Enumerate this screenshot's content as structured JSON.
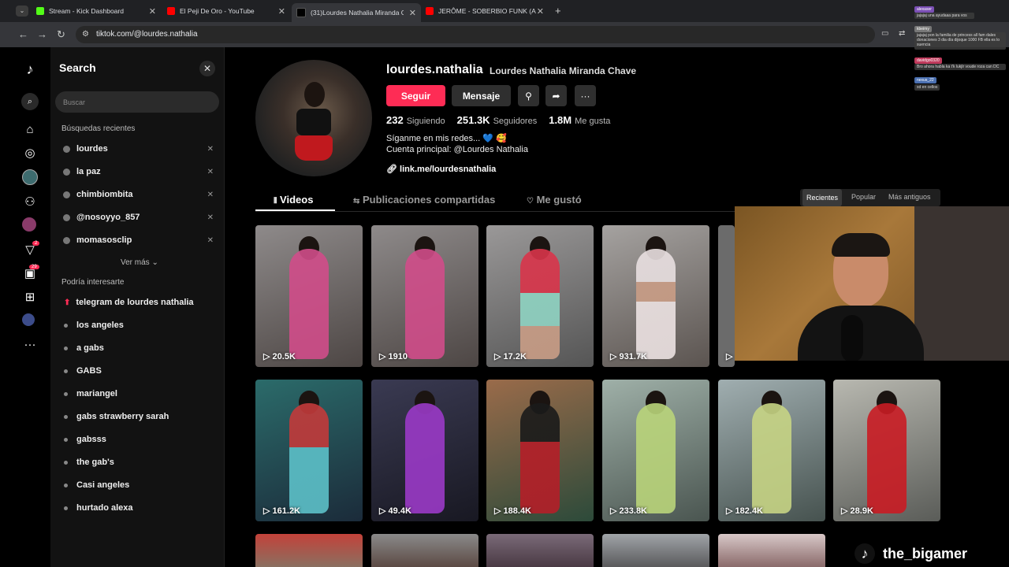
{
  "browser": {
    "tabs": [
      {
        "title": "Stream - Kick Dashboard",
        "fav_color": "#53fc18"
      },
      {
        "title": "El Peji De Oro - YouTube",
        "fav_color": "#ff0000"
      },
      {
        "title": "(31)Lourdes Nathalia Miranda C",
        "fav_color": "#000000"
      },
      {
        "title": "JERÔME - SOBERBIO FUNK (Au",
        "fav_color": "#ff0000"
      }
    ],
    "url": "tiktok.com/@lourdes.nathalia"
  },
  "rail": {
    "icons": [
      "tiktok-logo-icon",
      "search-icon",
      "home-icon",
      "explore-icon",
      "following-avatar-icon",
      "friends-icon",
      "live-avatar-icon",
      "inbox-icon",
      "messages-icon",
      "upload-icon",
      "profile-avatar-icon",
      "more-icon"
    ],
    "inbox_badge": "2",
    "messages_badge": "29"
  },
  "search": {
    "title": "Search",
    "placeholder": "Buscar",
    "recent_heading": "Búsquedas recientes",
    "recent": [
      "lourdes",
      "la paz",
      "chimbiombita",
      "@nosoyyo_857",
      "momasosclip"
    ],
    "see_more": "Ver más",
    "suggest_heading": "Podría interesarte",
    "suggestions": [
      "telegram de lourdes nathalia",
      "los angeles",
      "a gabs",
      "GABS",
      "mariangel",
      "gabs strawberry sarah",
      "gabsss",
      "the gab's",
      "Casi angeles",
      "hurtado alexa"
    ]
  },
  "profile": {
    "username": "lourdes.nathalia",
    "display_name": "Lourdes Nathalia Miranda Chave",
    "follow_label": "Seguir",
    "message_label": "Mensaje",
    "following_count": "232",
    "following_label": "Siguiendo",
    "followers_count": "251.3K",
    "followers_label": "Seguidores",
    "likes_count": "1.8M",
    "likes_label": "Me gusta",
    "bio_line1": "Síganme en mis redes... 💙 🥰",
    "bio_line2": "Cuenta principal: @Lourdes Nathalia",
    "link": "link.me/lourdesnathalia"
  },
  "content_tabs": [
    "Videos",
    "Publicaciones compartidas",
    "Me gustó"
  ],
  "sort": [
    "Recientes",
    "Popular",
    "Más antiguos"
  ],
  "videos_row1": [
    {
      "views": "20.5K",
      "color": "#d04c8a"
    },
    {
      "views": "1910",
      "color": "#d04c8a"
    },
    {
      "views": "17.2K",
      "color": "#d9344a"
    },
    {
      "views": "931.7K",
      "color": "#e8dfe0"
    },
    {
      "views": "",
      "color": "#6b6b6b"
    }
  ],
  "videos_row2": [
    {
      "views": "161.2K",
      "color": "#5cc0c8"
    },
    {
      "views": "49.4K",
      "color": "#9a3ac6"
    },
    {
      "views": "188.4K",
      "color": "#b41e28"
    },
    {
      "views": "233.8K",
      "color": "#b9d47a"
    },
    {
      "views": "182.4K",
      "color": "#c6d484"
    },
    {
      "views": "28.9K",
      "color": "#c91c24"
    }
  ],
  "chat": [
    {
      "name": "alexaser",
      "text": "jajajaj una ayudaaa para vos",
      "color": "#7b4fb5"
    },
    {
      "name": "kbeimy",
      "text": "jajajaj pon la familia de princess all fam dales donaciones 3 dia día dijoque 1000 FB ella es lo suencia",
      "color": "#777777"
    },
    {
      "name": "davidgo0320",
      "text": "Bro ahora habla ka t'k lukjlr voude roza can DC",
      "color": "#c03a5c"
    },
    {
      "name": "nexus_22",
      "text": "xd en cellos",
      "color": "#4a6fb0"
    }
  ],
  "streamer": {
    "handle": "the_bigamer"
  }
}
